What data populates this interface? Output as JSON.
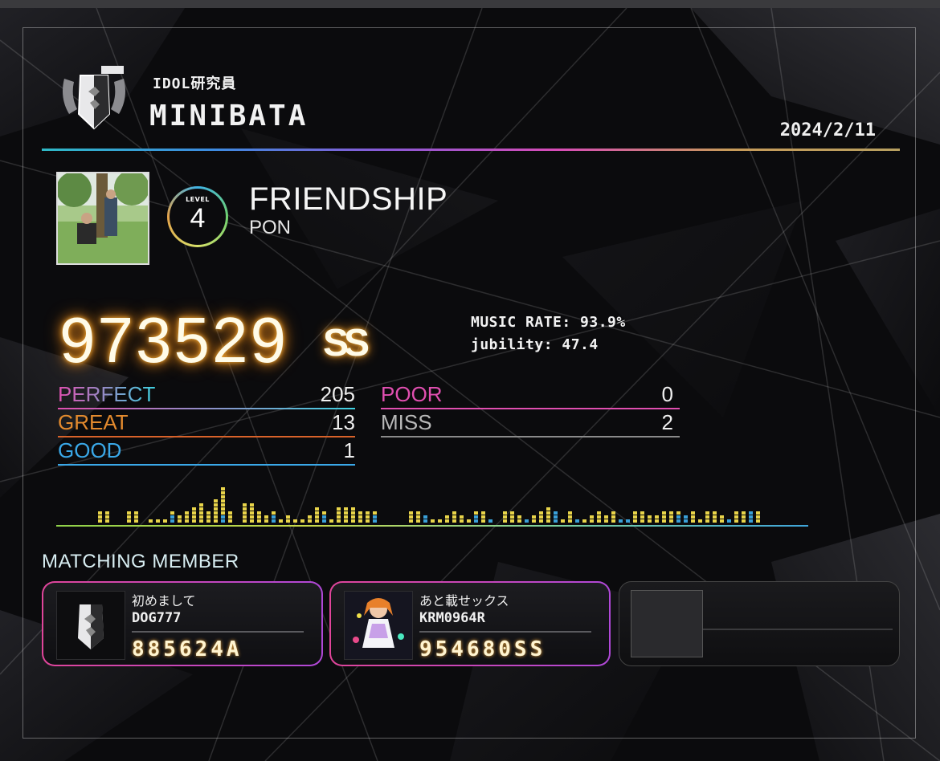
{
  "header": {
    "title_small": "IDOL研究員",
    "player_name": "MINIBATA",
    "date": "2024/2/11"
  },
  "song": {
    "level_label": "LEVEL",
    "level": "4",
    "title": "FRIENDSHIP",
    "artist": "PON"
  },
  "result": {
    "score": "973529",
    "rank": "SS",
    "music_rate": "MUSIC RATE: 93.9%",
    "jubility": "jubility: 47.4"
  },
  "judgements": [
    {
      "label": "PERFECT",
      "value": "205",
      "color": "#e04fb0",
      "color2": "#3fd0e0"
    },
    {
      "label": "GREAT",
      "value": "13",
      "color": "#e08a30",
      "color2": "#d8622a"
    },
    {
      "label": "GOOD",
      "value": "1",
      "color": "#3aa8e8",
      "color2": "#3aa8e8"
    },
    {
      "label": "POOR",
      "value": "0",
      "color": "#e04fb0",
      "color2": "#e04fb0"
    },
    {
      "label": "MISS",
      "value": "2",
      "color": "#b8b8b8",
      "color2": "#b8b8b8"
    }
  ],
  "matching": {
    "title": "MATCHING MEMBER",
    "members": [
      {
        "title": "初めまして",
        "name": "DOG777",
        "score": "885624A"
      },
      {
        "title": "あと載せックス",
        "name": "KRM0964R",
        "score": "954680SS"
      }
    ]
  },
  "colors": {
    "accent_gold": "#ffb43a",
    "card_border": "#e0459a"
  }
}
